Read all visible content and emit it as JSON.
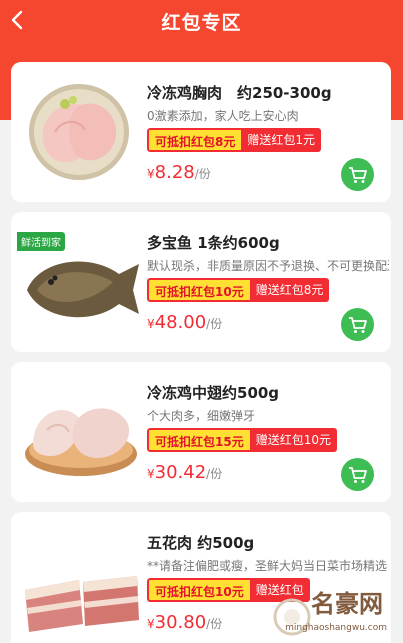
{
  "header": {
    "title": "红包专区"
  },
  "products": [
    {
      "name": "冷冻鸡胸肉　约250-300g",
      "desc": "0激素添加，家人吃上安心肉",
      "deduct": "可抵扣红包8元",
      "gift": "赠送红包1元",
      "yen": "¥",
      "price": "8.28",
      "unit": "/份"
    },
    {
      "name": "多宝鱼 1条约600g",
      "desc": "默认现杀，非质量原因不予退换、不可更换配送",
      "deduct": "可抵扣红包10元",
      "gift": "赠送红包8元",
      "yen": "¥",
      "price": "48.00",
      "unit": "/份",
      "tag": "鲜活到家"
    },
    {
      "name": "冷冻鸡中翅约500g",
      "desc": "个大肉多，细嫩弹牙",
      "deduct": "可抵扣红包15元",
      "gift": "赠送红包10元",
      "yen": "¥",
      "price": "30.42",
      "unit": "/份"
    },
    {
      "name": "五花肉 约500g",
      "desc": "**请备注偏肥或瘦，圣鲜大妈当日菜市场精选",
      "deduct": "可抵扣红包10元",
      "gift": "赠送红包",
      "yen": "¥",
      "price": "30.80",
      "unit": "/份"
    }
  ],
  "watermark": {
    "text": "名豪网",
    "url": "minghaoshangwu.com"
  }
}
